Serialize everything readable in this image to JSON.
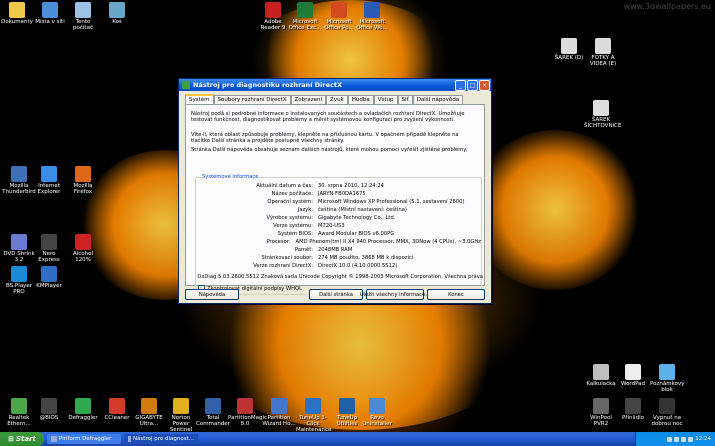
{
  "desktop": {
    "watermark": "www.3dwallpapers.eu",
    "icons": [
      {
        "name": "dokumenty",
        "label": "Dokumenty",
        "icon": "folder-icon",
        "color": "#f1c84b"
      },
      {
        "name": "mista-v-siti",
        "label": "Místa v síti",
        "icon": "network-icon",
        "color": "#4a8fd8"
      },
      {
        "name": "tento-pocitac",
        "label": "Tento počítač",
        "icon": "computer-icon",
        "color": "#9cc0e6"
      },
      {
        "name": "kos",
        "label": "Koš",
        "icon": "recycle-bin-icon",
        "color": "#6aa6c9"
      },
      {
        "name": "adobe-reader",
        "label": "Adobe Reader 9",
        "icon": "adobe-reader-icon",
        "color": "#c62020"
      },
      {
        "name": "office-powerpoint",
        "label": "Microsoft Office Po...",
        "icon": "powerpoint-icon",
        "color": "#d24a1e"
      },
      {
        "name": "office-word",
        "label": "Microsoft Office Wo...",
        "icon": "word-icon",
        "color": "#2a5ab8"
      },
      {
        "name": "office-excel",
        "label": "Microsoft Office Exc...",
        "icon": "excel-icon",
        "color": "#1f7a3a"
      },
      {
        "name": "sarek-d",
        "label": "ŠAREK (D)",
        "icon": "drive-icon",
        "color": "#dcdcdc"
      },
      {
        "name": "fotky-videa",
        "label": "FOTKY A VIDEA (E)",
        "icon": "drive-icon",
        "color": "#dcdcdc"
      },
      {
        "name": "sarek-sichtovnice",
        "label": "ŠAREK ŠICHTOVNICE",
        "icon": "spreadsheet-icon",
        "color": "#dddddd"
      },
      {
        "name": "mozilla-thunderbird",
        "label": "Mozilla Thunderbird",
        "icon": "thunderbird-icon",
        "color": "#3e6fb4"
      },
      {
        "name": "internet-explorer",
        "label": "Internet Explorer",
        "icon": "ie-icon",
        "color": "#3a8ee6"
      },
      {
        "name": "mozilla-firefox",
        "label": "Mozilla Firefox",
        "icon": "firefox-icon",
        "color": "#e0661a"
      },
      {
        "name": "dvd-shrink",
        "label": "DVD Shrink 3.2",
        "icon": "dvd-icon",
        "color": "#6a7bd1"
      },
      {
        "name": "nero-express",
        "label": "Nero Express",
        "icon": "nero-icon",
        "color": "#444444"
      },
      {
        "name": "alcohol-120",
        "label": "Alcohol 120%",
        "icon": "alcohol-icon",
        "color": "#c22"
      },
      {
        "name": "bsplayer",
        "label": "BS.Player PRO",
        "icon": "player-icon",
        "color": "#1b8ad6"
      },
      {
        "name": "kmplayer",
        "label": "KMPlayer",
        "icon": "player-icon",
        "color": "#2f6fc2"
      },
      {
        "name": "kalkulacka",
        "label": "Kalkulačka",
        "icon": "calculator-icon",
        "color": "#bfbfbf"
      },
      {
        "name": "wordpad",
        "label": "WordPad",
        "icon": "wordpad-icon",
        "color": "#eeeeee"
      },
      {
        "name": "poznamkovy-blok",
        "label": "Poznámkový blok",
        "icon": "notepad-icon",
        "color": "#5db1e8"
      },
      {
        "name": "realtek",
        "label": "Realtek Ethern...",
        "icon": "network-card-icon",
        "color": "#4aa64a"
      },
      {
        "name": "4bios",
        "label": "@BIOS",
        "icon": "bios-icon",
        "color": "#444"
      },
      {
        "name": "defraggler",
        "label": "Defraggler",
        "icon": "defrag-icon",
        "color": "#2fa84f"
      },
      {
        "name": "ccleaner",
        "label": "CCleaner",
        "icon": "ccleaner-icon",
        "color": "#d23b2b"
      },
      {
        "name": "gigabyte-ultra",
        "label": "GIGABYTE Ultra...",
        "icon": "gigabyte-icon",
        "color": "#d07a10"
      },
      {
        "name": "norton",
        "label": "Norton Power Sentinel",
        "icon": "norton-icon",
        "color": "#e0b020"
      },
      {
        "name": "total-commander",
        "label": "Total Commander",
        "icon": "floppy-icon",
        "color": "#335fa6"
      },
      {
        "name": "partitionmagic",
        "label": "PartitionMagic 8.0",
        "icon": "partition-icon",
        "color": "#bb3333"
      },
      {
        "name": "partition-wizard",
        "label": "Partition Wizard Ho...",
        "icon": "partition-icon",
        "color": "#4477cc"
      },
      {
        "name": "tuneup-1click",
        "label": "TuneUp 1-Click Maintenance",
        "icon": "tuneup-icon",
        "color": "#2a72c2"
      },
      {
        "name": "tuneup-utilities",
        "label": "TuneUp Utilities",
        "icon": "tuneup-icon",
        "color": "#1e5fa8"
      },
      {
        "name": "revo-uninstaller",
        "label": "Revo Uninstaller",
        "icon": "revo-icon",
        "color": "#4c8bd4"
      },
      {
        "name": "winpool-pvr",
        "label": "WinPool PVR2",
        "icon": "tv-icon",
        "color": "#666"
      },
      {
        "name": "prinidlo",
        "label": "Přiniidlo",
        "icon": "printer-icon",
        "color": "#444"
      },
      {
        "name": "vypnut-na-dobrou-noc",
        "label": "Vypnuť na dobrou noc",
        "icon": "power-icon",
        "color": "#333"
      }
    ]
  },
  "window": {
    "title": "Nástroj pro diagnostiku rozhraní DirectX",
    "tabs": [
      "Systém",
      "Soubory rozhraní DirectX",
      "Zobrazení",
      "Zvuk",
      "Hudba",
      "Vstup",
      "Síť",
      "Další nápověda"
    ],
    "active_tab": 0,
    "paragraphs": [
      "Nástroj podá si podrobné informace o instalovaných součástech a ovladačích rozhraní DirectX. Umožňuje testovat funkčnost, diagnostikovat problémy a měnit systémovou konfiguraci pro zvýšení výkonnosti.",
      "Víte-li, která oblast způsobuje problémy, klepněte na příslušnou kartu. V opačném případě klepněte na tlačítko Další stránka a projděte postupně všechny stránky.",
      "Stránka Další nápověda obsahuje seznam dalších nástrojů, které mohou pomoci vyřešit zjištěné problémy."
    ],
    "group_label": "Systémové informace",
    "info_rows": [
      {
        "key": "Aktuální datum a čas:",
        "value": "30. srpna 2010, 12:24:24"
      },
      {
        "key": "Název počítače:",
        "value": "JARYN-FB0DA1675"
      },
      {
        "key": "Operační systém:",
        "value": "Microsoft Windows XP Professional (5.1, sestavení 2600)"
      },
      {
        "key": "Jazyk:",
        "value": "čeština (Místní nastavení: čeština)"
      },
      {
        "key": "Výrobce systému:",
        "value": "Gigabyte Technology Co., Ltd."
      },
      {
        "key": "Verze systému:",
        "value": "M720-US3"
      },
      {
        "key": "Systém BIOS:",
        "value": "Award Modular BIOS v6.00PG"
      },
      {
        "key": "Procesor:",
        "value": "AMD Phenom(tm) II X4 940 Processor,  MMX,  3DNow (4 CPUs), ~3.0GHz"
      },
      {
        "key": "Paměť:",
        "value": "2048MB RAM"
      },
      {
        "key": "Stránkovací soubor:",
        "value": "274 MB použito, 3868 MB k dispozici"
      },
      {
        "key": "Verze rozhraní DirectX:",
        "value": "DirectX 10.0 (4.10.0000.5512)"
      }
    ],
    "whql_label": "Zkontrolovat digitální podpisy WHQL",
    "footer": "DxDiag 5.03.2600.5512 Znaková sada Unicode  Copyright © 1998-2003 Microsoft Corporation. Všechna práva",
    "buttons": {
      "help": "Nápověda",
      "next": "Další stránka",
      "save": "Uložit všechny informace...",
      "exit": "Konec"
    }
  },
  "taskbar": {
    "start": "Start",
    "tasks": [
      {
        "label": "Piriform Defraggler",
        "icon": "defrag-icon"
      },
      {
        "label": "Nástroj pro diagnost...",
        "icon": "dxdiag-icon"
      }
    ],
    "clock": "12:24"
  }
}
